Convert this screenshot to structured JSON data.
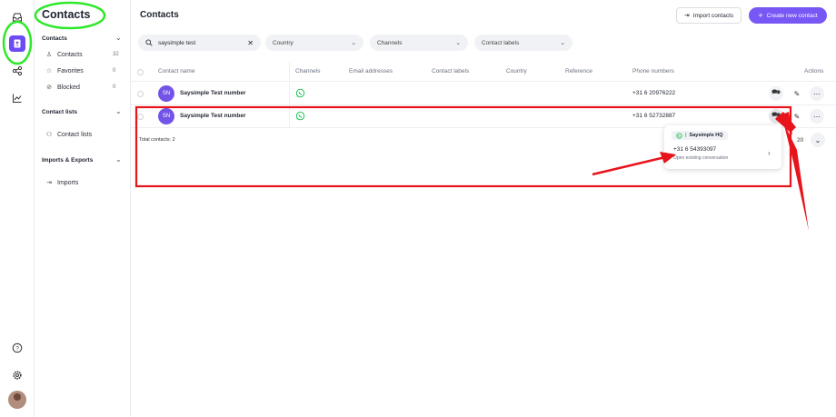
{
  "sidebar": {
    "title": "Contacts",
    "sections": [
      {
        "label": "Contacts",
        "items": [
          {
            "label": "Contacts",
            "count": "32"
          },
          {
            "label": "Favorites",
            "count": "0"
          },
          {
            "label": "Blocked",
            "count": "0"
          }
        ]
      },
      {
        "label": "Contact lists",
        "items": [
          {
            "label": "Contact lists"
          }
        ]
      },
      {
        "label": "Imports & Exports",
        "items": [
          {
            "label": "Imports"
          }
        ]
      }
    ]
  },
  "header": {
    "title": "Contacts",
    "import_label": "Import contacts",
    "create_label": "Create new contact"
  },
  "filters": {
    "search_value": "saysimple test",
    "country": "Country",
    "channels": "Channels",
    "contact_labels": "Contact labels"
  },
  "table": {
    "columns": [
      "Contact name",
      "Channels",
      "Email addresses",
      "Contact labels",
      "Country",
      "Reference",
      "Phone numbers",
      "Actions"
    ],
    "rows": [
      {
        "initials": "SN",
        "name": "Saysimple Test number",
        "phone": "+31 6 20976222"
      },
      {
        "initials": "SN",
        "name": "Saysimple Test number",
        "phone": "+31 6 52732887"
      }
    ],
    "total": "Total contacts: 2",
    "page_size": "20"
  },
  "popover": {
    "channel": "Saysimple HQ",
    "phone": "+31 6 54393097",
    "subtitle": "Open existing conversation"
  },
  "colors": {
    "accent": "#7857f5",
    "annotation_red": "#e8141c",
    "annotation_green": "#2ee82a",
    "whatsapp": "#25c25a"
  }
}
